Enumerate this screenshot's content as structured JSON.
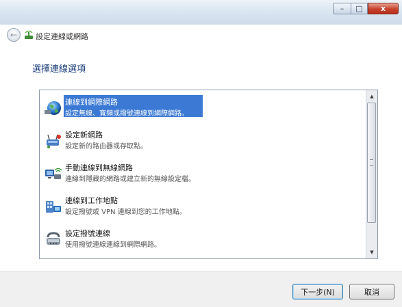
{
  "window": {
    "controls": {
      "minimize": "–",
      "maximize": "□",
      "close": "x"
    }
  },
  "wizard": {
    "back_glyph": "←",
    "title": "設定連線或網路",
    "heading": "選擇連線選項"
  },
  "options": [
    {
      "icon": "globe-icon",
      "title": "連線到網際網路",
      "desc": "設定無線、寬頻或撥號連線到網際網路。",
      "selected": true
    },
    {
      "icon": "router-icon",
      "title": "設定新網路",
      "desc": "設定新的路由器或存取點。",
      "selected": false
    },
    {
      "icon": "wireless-network-icon",
      "title": "手動連線到無線網路",
      "desc": "連線到隱藏的網路或建立新的無線設定檔。",
      "selected": false
    },
    {
      "icon": "workplace-icon",
      "title": "連線到工作地點",
      "desc": "設定撥號或 VPN 連線到您的工作地點。",
      "selected": false
    },
    {
      "icon": "dialup-modem-icon",
      "title": "設定撥號連線",
      "desc": "使用撥號連線連線到網際網路。",
      "selected": false
    }
  ],
  "scrollbar": {
    "up_glyph": "▲",
    "down_glyph": "▼"
  },
  "buttons": {
    "next": "下一步(N)",
    "cancel": "取消"
  },
  "colors": {
    "selection": "#3b79d4",
    "heading": "#1a3e7a",
    "close_button": "#c8412c"
  }
}
